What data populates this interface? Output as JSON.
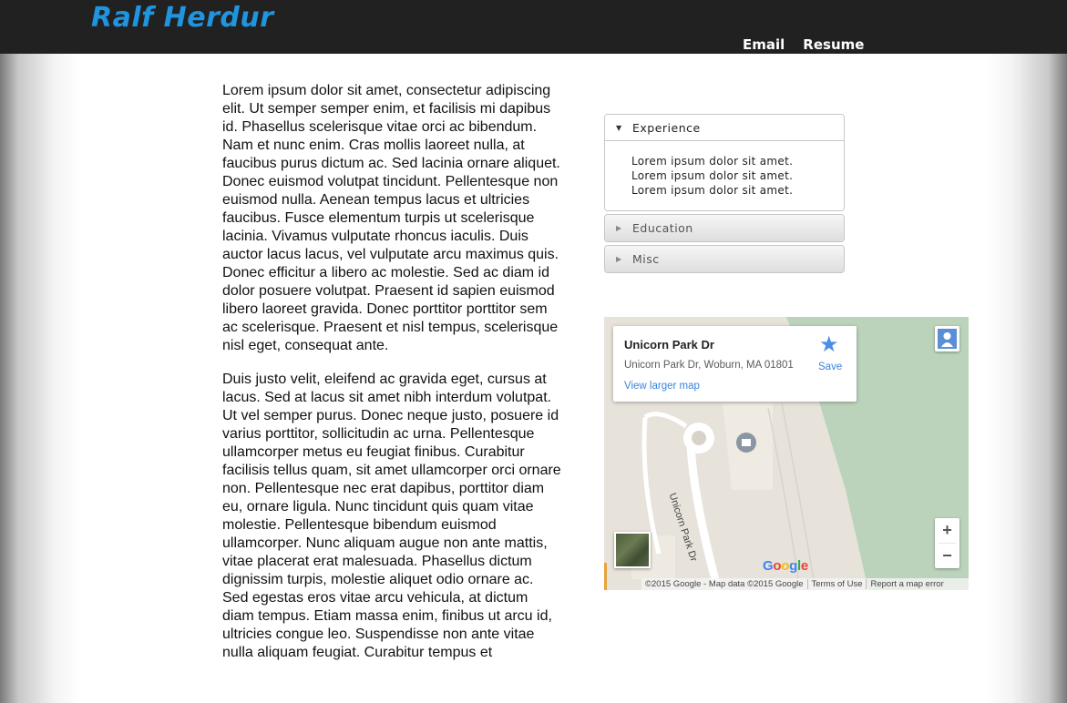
{
  "header": {
    "logo": "Ralf Herdur",
    "nav": [
      {
        "label": "Email"
      },
      {
        "label": "Resume"
      }
    ]
  },
  "article": {
    "paragraphs": [
      "Lorem ipsum dolor sit amet, consectetur adipiscing elit. Ut semper semper enim, et facilisis mi dapibus id. Phasellus scelerisque vitae orci ac bibendum. Nam et nunc enim. Cras mollis laoreet nulla, at faucibus purus dictum ac. Sed lacinia ornare aliquet. Donec euismod volutpat tincidunt. Pellentesque non euismod nulla. Aenean tempus lacus et ultricies faucibus. Fusce elementum turpis ut scelerisque lacinia. Vivamus vulputate rhoncus iaculis. Duis auctor lacus lacus, vel vulputate arcu maximus quis. Donec efficitur a libero ac molestie. Sed ac diam id dolor posuere volutpat. Praesent id sapien euismod libero laoreet gravida. Donec porttitor porttitor sem ac scelerisque. Praesent et nisl tempus, scelerisque nisl eget, consequat ante.",
      "Duis justo velit, eleifend ac gravida eget, cursus at lacus. Sed at lacus sit amet nibh interdum volutpat. Ut vel semper purus. Donec neque justo, posuere id varius porttitor, sollicitudin ac urna. Pellentesque ullamcorper metus eu feugiat finibus. Curabitur facilisis tellus quam, sit amet ullamcorper orci ornare non. Pellentesque nec erat dapibus, porttitor diam eu, ornare ligula. Nunc tincidunt quis quam vitae molestie. Pellentesque bibendum euismod ullamcorper. Nunc aliquam augue non ante mattis, vitae placerat erat malesuada. Phasellus dictum dignissim turpis, molestie aliquet odio ornare ac. Sed egestas eros vitae arcu vehicula, at dictum diam tempus. Etiam massa enim, finibus ut arcu id, ultricies congue leo. Suspendisse non ante vitae nulla aliquam feugiat. Curabitur tempus et"
    ]
  },
  "accordion": {
    "sections": [
      {
        "label": "Experience",
        "open": true,
        "lines": [
          "Lorem ipsum dolor sit amet.",
          "Lorem ipsum dolor sit amet.",
          "Lorem ipsum dolor sit amet."
        ]
      },
      {
        "label": "Education",
        "open": false
      },
      {
        "label": "Misc",
        "open": false
      }
    ]
  },
  "map": {
    "place_name": "Unicorn Park Dr",
    "address": "Unicorn Park Dr, Woburn, MA 01801",
    "view_larger": "View larger map",
    "save_label": "Save",
    "road_label": "Unicorn Park Dr",
    "zoom_in": "+",
    "zoom_out": "−",
    "logo": "Google",
    "footer": {
      "copyright": "©2015 Google - Map data ©2015 Google",
      "terms": "Terms of Use",
      "report": "Report a map error"
    },
    "colors": {
      "land": "#e7e2da",
      "park": "#bcd3bb",
      "road": "#ffffff",
      "link": "#3a84df"
    }
  },
  "icons": {
    "star": "star-icon",
    "pegman": "pegman-icon",
    "triangle_open": "▼",
    "triangle_closed": "▶"
  }
}
